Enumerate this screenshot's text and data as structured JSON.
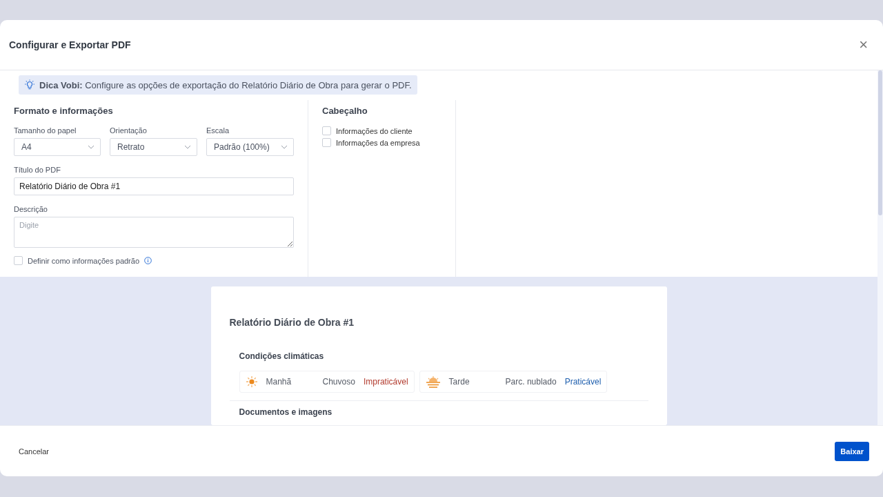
{
  "dialog": {
    "title": "Configurar e Exportar PDF",
    "close": "×"
  },
  "tip": {
    "label": "Dica Vobi:",
    "text": "Configure as opções de exportação do Relatório Diário de Obra para gerar o PDF."
  },
  "format": {
    "heading": "Formato e informações",
    "selects": [
      {
        "label": "Tamanho do papel",
        "value": "A4"
      },
      {
        "label": "Orientação",
        "value": "Retrato"
      },
      {
        "label": "Escala",
        "value": "Padrão (100%)"
      }
    ],
    "title_field": {
      "label": "Título do PDF",
      "value": "Relatório Diário de Obra #1"
    },
    "description_field": {
      "label": "Descrição",
      "placeholder": "Digite"
    },
    "default_checkbox": {
      "label": "Definir como informações padrão",
      "checked": false
    }
  },
  "header_section": {
    "heading": "Cabeçalho",
    "options": [
      {
        "label": "Informações do cliente",
        "checked": false
      },
      {
        "label": "Informações da empresa",
        "checked": false
      }
    ]
  },
  "preview": {
    "title": "Relatório Diário de Obra #1",
    "weather_heading": "Condições climáticas",
    "weather": [
      {
        "kind": "sun",
        "period": "Manhã",
        "condition": "Chuvoso",
        "status": "Impraticável",
        "color": "#b23b2e"
      },
      {
        "kind": "sunset",
        "period": "Tarde",
        "condition": "Parc. nublado",
        "status": "Praticável",
        "color": "#1f5fae"
      }
    ],
    "next_heading": "Documentos e imagens"
  },
  "footer": {
    "cancel": "Cancelar",
    "download": "Baixar"
  }
}
